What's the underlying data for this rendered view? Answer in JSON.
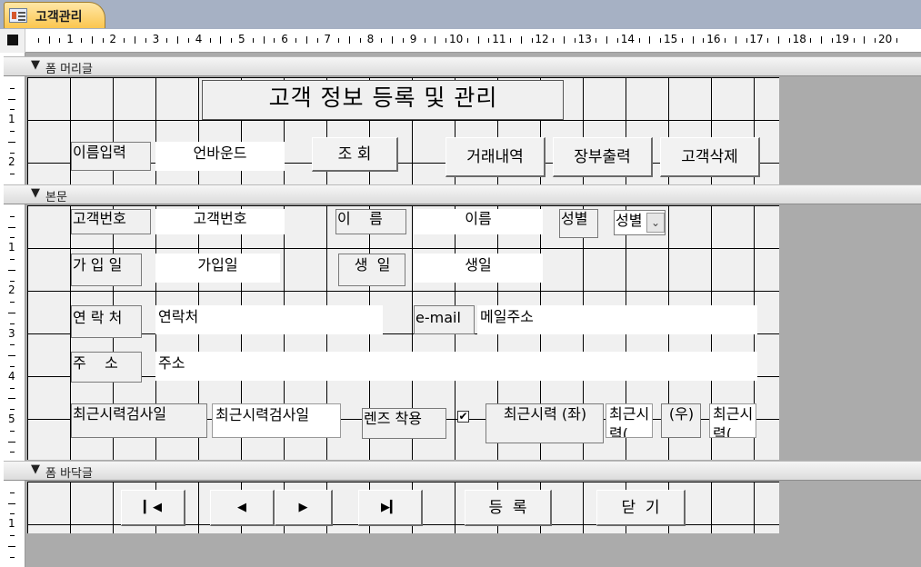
{
  "tab": {
    "title": "고객관리"
  },
  "ruler": {
    "h": [
      "1",
      "2",
      "3",
      "4",
      "5",
      "6",
      "7",
      "8",
      "9",
      "10",
      "11",
      "12",
      "13",
      "14",
      "15",
      "16",
      "17",
      "18",
      "19",
      "20"
    ],
    "v_header": [
      "1",
      "2"
    ],
    "v_body": [
      "1",
      "2",
      "3",
      "4",
      "5"
    ],
    "v_footer": [
      "1"
    ]
  },
  "sections": {
    "header": "폼 머리글",
    "body": "본문",
    "footer": "폼 바닥글"
  },
  "header": {
    "title": "고객 정보 등록 및 관리",
    "name_label": "이름입력",
    "name_input": "언바운드",
    "search_btn": "조 회",
    "history_btn": "거래내역",
    "ledger_btn": "장부출력",
    "delete_btn": "고객삭제"
  },
  "body": {
    "customer_id_label": "고객번호",
    "customer_id_field": "고객번호",
    "name_label": "이    름",
    "name_field": "이름",
    "gender_label": "성별",
    "gender_field": "성별",
    "join_label": "가 입 일",
    "join_field": "가입일",
    "birth_label": "생  일",
    "birth_field": "생일",
    "phone_label": "연 락 처",
    "phone_field": "연락처",
    "email_label": "e-mail",
    "email_field": "메일주소",
    "address_label": "주    소",
    "address_field": "주소",
    "recent_exam_label": "최근시력검사일",
    "recent_exam_field": "최근시력검사일",
    "lens_label": "렌즈 착용",
    "left_eye_label": "최근시력 (좌)",
    "left_eye_field": "최근시력(",
    "right_eye_label": "(우)",
    "right_eye_field": "최근시력("
  },
  "footer": {
    "first_icon": "first-record-icon",
    "prev_icon": "previous-record-icon",
    "next_icon": "next-record-icon",
    "last_icon": "last-record-icon",
    "register_btn": "등  록",
    "close_btn": "닫  기"
  }
}
